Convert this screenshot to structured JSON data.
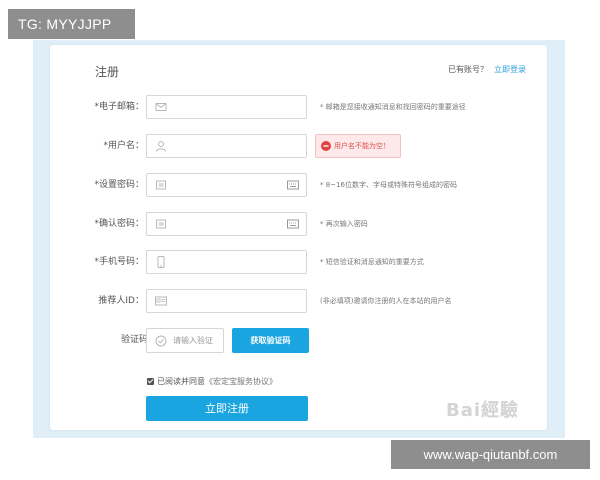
{
  "badges": {
    "tg": "TG: MYYJJPP",
    "watermark": "www.wap-qiutanbf.com",
    "baidu": "Bai經驗"
  },
  "header": {
    "title": "注册",
    "login_hint": "已有账号？",
    "login_link": "立即登录"
  },
  "form": {
    "email": {
      "label": "*电子邮箱：",
      "hint": "* 邮箱是您接收通知消息和找回密码的重要途径"
    },
    "username": {
      "label": "*用户名：",
      "error": "用户名不能为空！"
    },
    "password": {
      "label": "*设置密码：",
      "hint": "* 8~16位数字、字母或特殊符号组成的密码"
    },
    "confirm": {
      "label": "*确认密码：",
      "hint": "* 再次输入密码"
    },
    "phone": {
      "label": "*手机号码：",
      "hint": "* 短信验证和消息通知的重要方式"
    },
    "referrer": {
      "label": "推荐人ID：",
      "hint": "(非必填项)邀请你注册的人在本站的用户名"
    },
    "captcha": {
      "label": "验证码",
      "placeholder": "请输入验证",
      "button": "获取验证码"
    },
    "agreement": {
      "text": "已阅读并同意",
      "link": "《宏定宝服务协议》"
    },
    "submit": "立即注册"
  },
  "colors": {
    "accent": "#1aa5e0",
    "error": "#d9534f",
    "outer_bg": "#dfeef7"
  }
}
